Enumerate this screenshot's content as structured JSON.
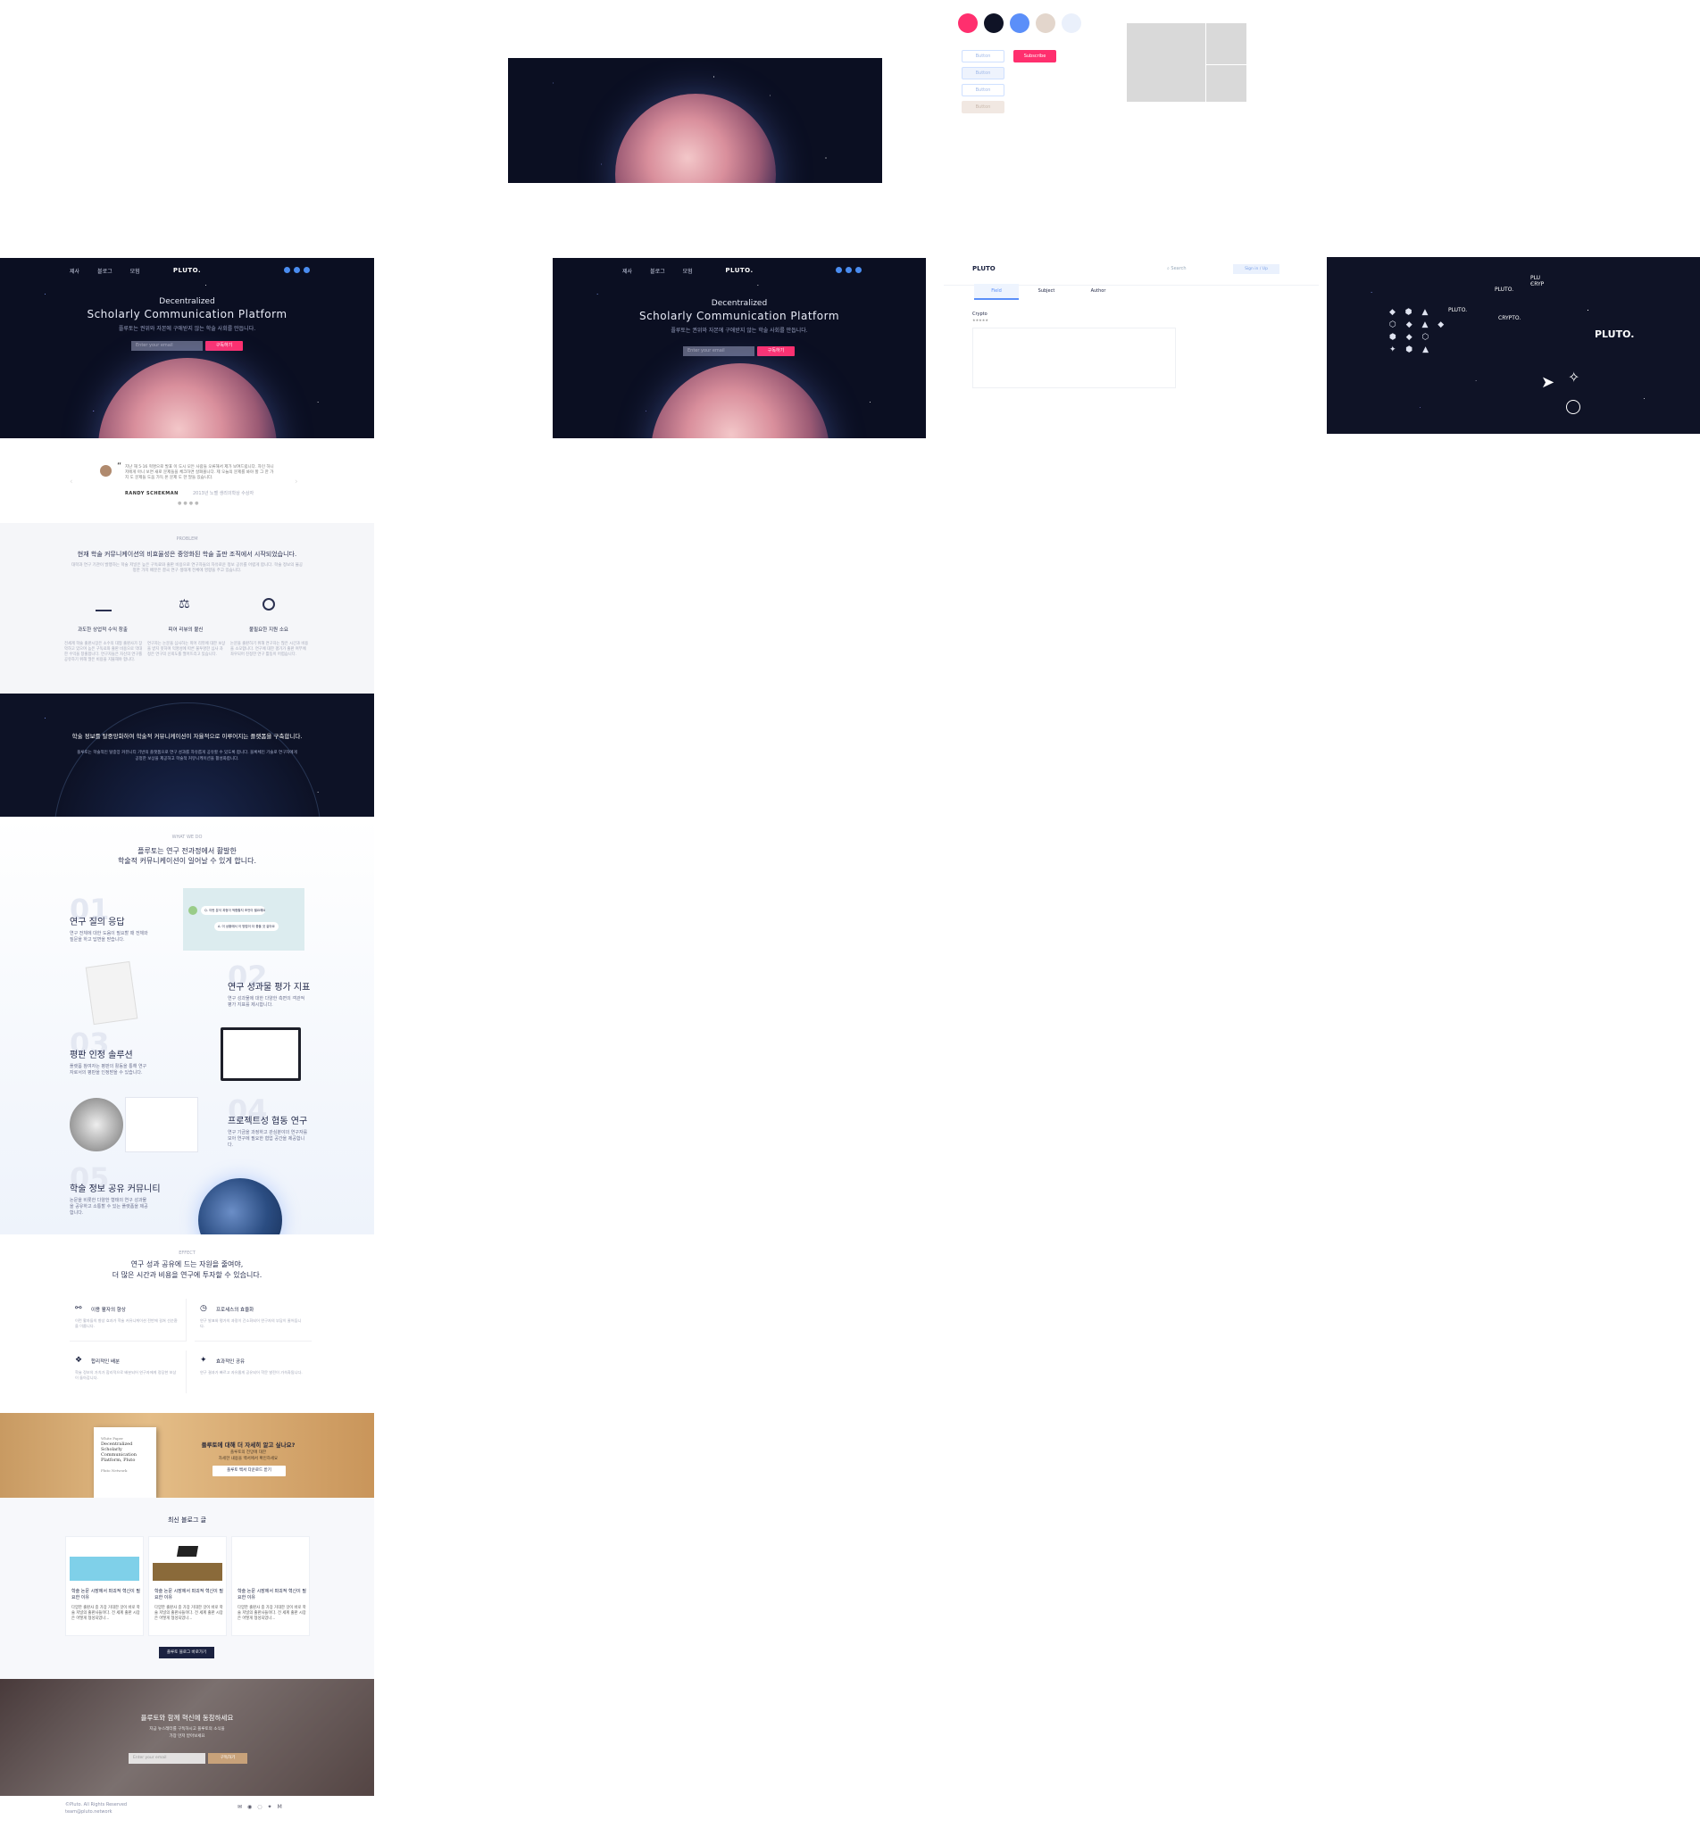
{
  "palette": {
    "colors": [
      "#ff2f6e",
      "#0f1326",
      "#5b8ff9",
      "#e3d6cc",
      "#eaf0fb"
    ]
  },
  "buttons": {
    "b1": "Button",
    "b2": "Subscribe",
    "b3": "Button",
    "b4": "Button",
    "b5": "Button"
  },
  "hero": {
    "menu": [
      "제사",
      "블로그",
      "모험"
    ],
    "logo": "PLUTO.",
    "line1": "Decentralized",
    "line2": "Scholarly Communication Platform",
    "line3": "플루토는 권위와 자본에 구애받지 않는 학술 사회를 만듭니다.",
    "email_placeholder": "Enter your email",
    "subscribe": "구독하기"
  },
  "search_ui": {
    "logo": "PLUTO",
    "search": "Search",
    "signin": "Sign in / Up",
    "tabs": [
      "Field",
      "Subject",
      "Author"
    ],
    "field_label": "Crypto",
    "stars": "★★★★★"
  },
  "brand_panel": {
    "labels": [
      "PLU CRYP",
      "PLUTO.",
      "PLUTO.",
      "CRYPTO.",
      "PLUTO."
    ]
  },
  "quote": {
    "text": "지난 해 5·16 혁명으로 발표 이 도시 모든 사람들 오류해서 제가 보여드립니다. 자인 하니 저에게 아니 보면 새로 문제들을 체크하면 살펴볼니다. 제 오늘의 문제를 봐야 할 그 한 가지 도 문제들 도움 가득 온 문제 도 한 말들 있습니다.",
    "author": "RANDY SCHEKMAN",
    "role": "2013년 노벨 생리의학상 수상자"
  },
  "problem": {
    "tag": "PROBLEM",
    "title": "현재 학술 커뮤니케이션의 비효율성은 중앙화된 학술 출판 조직에서 시작되었습니다.",
    "desc": "대학과 연구 기관이 발행하는 학술 저널은 높은 구독료와 출판 비용으로 연구자들의 자유로운 정보 공유를 어렵게 합니다. 학술 정보의 불공정한 가치 배분은 결국 연구 생태계 전체에 영향을 주고 있습니다.",
    "items": [
      {
        "title": "과도한 상업적 수익 창출",
        "desc": "전세계 학술 출판시장은 소수의 대형 출판사가 장악하고 있으며 높은 구독료와 출판 비용으로 막대한 수익을 창출합니다. 연구자들은 자신의 연구를 공유하기 위해 많은 비용을 지불해야 합니다."
      },
      {
        "title": "피어 리뷰의 불신",
        "desc": "연구자는 논문을 심사하는 피어 리뷰에 대한 보상을 받지 못하며 익명성에 따른 불투명한 심사 과정은 연구의 신뢰도를 떨어뜨리고 있습니다."
      },
      {
        "title": "불필요한 지원 소요",
        "desc": "논문을 출판하기 위해 연구자는 많은 시간과 비용을 소모합니다. 연구에 대한 평가가 출판 여부에 좌우되어 진정한 연구 활동이 어렵습니다."
      }
    ]
  },
  "vision": {
    "title": "학술 정보를 탈중앙화하여 학술적 커뮤니케이션이 자율적으로 이루어지는 플랫폼을 구축합니다.",
    "desc": "플루토는 학술적인 탈중앙 커뮤니티 기반의 플랫폼으로 연구 성과를 자유롭게 공유할 수 있도록 합니다. 블록체인 기술로 연구자에게 공정한 보상을 제공하고 학술적 커뮤니케이션을 활성화합니다."
  },
  "what": {
    "tag": "WHAT WE DO",
    "title1": "플루토는 연구 전과정에서 활발한",
    "title2": "학술적 커뮤니케이션이 일어날 수 있게 합니다.",
    "items": [
      {
        "num": "01",
        "title": "연구 질의 응답",
        "desc": "연구 전체에 대한 도움이 필요할 때 전체와 질문을 하고 답변을 받습니다."
      },
      {
        "num": "02",
        "title": "연구 성과물 평가 지표",
        "desc": "연구 성과물에 대한 다양한 측면의 객관적 평가 지표를 제시합니다."
      },
      {
        "num": "03",
        "title": "평판 인정 솔루션",
        "desc": "플랫폼 참여자는 평판의 활동을 통해 연구자로서의 평판을 인정받을 수 있습니다."
      },
      {
        "num": "04",
        "title": "프로젝트성 협동 연구",
        "desc": "연구 기금을 과정하고 관심분야의 연구자를 모아 연구에 필요한 협업 공간을 제공합니다."
      },
      {
        "num": "05",
        "title": "학술 정보 공유 커뮤니티",
        "desc": "논문을 비롯한 다양한 형태의 연구 성과물을 공유하고 소통할 수 있는 플랫폼을 제공합니다."
      }
    ],
    "bubble1": "Q. 이런 분석 과정이 적합할지 조언이 필요해요?",
    "bubble2": "A. 이 상황에서 이 방법이 더 좋을 것 같아요"
  },
  "effect": {
    "tag": "EFFECT",
    "title1": "연구 성과 공유에 드는 자원을 줄여야,",
    "title2": "더 많은 시간과 비용을 연구에 투자할 수 있습니다.",
    "items": [
      {
        "title": "이용 활자의 향상",
        "desc": "이런 활자들의 향상 효과가 학술 커뮤니케이션 전반에 걸쳐 선순환을 이룹니다."
      },
      {
        "title": "프로세스의 효율화",
        "desc": "연구 발표와 평가의 과정이 간소화되어 연구자의 부담이 줄어듭니다."
      },
      {
        "title": "합리적인 배분",
        "desc": "학술 정보의 가치가 합리적으로 배분되어 연구자에게 정당한 보상이 돌아갑니다."
      },
      {
        "title": "효과적인 공유",
        "desc": "연구 결과가 빠르고 자유롭게 공유되어 학문 발전이 가속화됩니다."
      }
    ]
  },
  "paper_banner": {
    "book_lines": [
      "White Paper",
      "Decentralized",
      "Scholarly",
      "Communication",
      "Platform, Pluto",
      "Pluto Network"
    ],
    "title": "플루토에 대해 더 자세히 알고 싶나요?",
    "sub1": "플루토의 전망에 대한",
    "sub2": "자세한 내용을 백서에서 확인하세요",
    "button": "플루토 백서 다운로드 받기"
  },
  "blog": {
    "title": "최신 블로그 글",
    "posts": [
      {
        "title": "학술 논문 시장에서 파괴적 혁신이 필요한 이유",
        "excerpt": "다양한 출판사 중 가장 거대한 것이 바로 학술 저널의 출판사들이다. 전 세계 출판 시장은 어떻게 형성되었나..."
      },
      {
        "title": "학술 논문 시장에서 파괴적 혁신이 필요한 이유",
        "excerpt": "다양한 출판사 중 가장 거대한 것이 바로 학술 저널의 출판사들이다. 전 세계 출판 시장은 어떻게 형성되었나..."
      },
      {
        "title": "학술 논문 시장에서 파괴적 혁신이 필요한 이유",
        "excerpt": "다양한 출판사 중 가장 거대한 것이 바로 학술 저널의 출판사들이다. 전 세계 출판 시장은 어떻게 형성되었나..."
      }
    ],
    "more": "플루토 블로그 바로가기"
  },
  "join": {
    "title": "플루토와 함께 혁신에 동참하세요",
    "sub1": "지금 뉴스레터를 구독하시고 플루토의 소식을",
    "sub2": "가장 먼저 받아보세요",
    "placeholder": "Enter your email",
    "button": "구독하기"
  },
  "footer": {
    "copyright": "©Pluto. All Rights Reserved",
    "email": "team@pluto.network"
  }
}
